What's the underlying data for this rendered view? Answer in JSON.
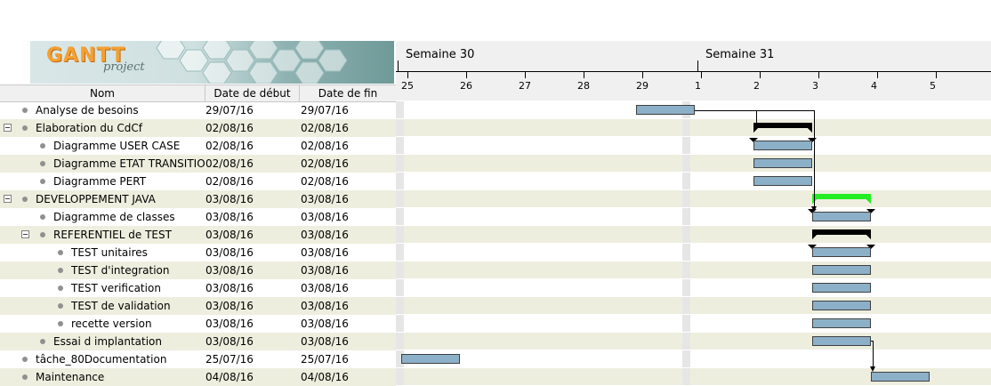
{
  "logo": {
    "main": "GANTT",
    "sub": "project"
  },
  "columns": {
    "name": "Nom",
    "start": "Date de début",
    "end": "Date de fin"
  },
  "weeks": [
    "Semaine 30",
    "Semaine 31"
  ],
  "days": [
    "25",
    "26",
    "27",
    "28",
    "29",
    "1",
    "2",
    "3",
    "4",
    "5"
  ],
  "tasks": [
    {
      "name": "Analyse de besoins",
      "start": "29/07/16",
      "end": "29/07/16",
      "level": 0,
      "group": false
    },
    {
      "name": "Elaboration du CdCf",
      "start": "02/08/16",
      "end": "02/08/16",
      "level": 0,
      "group": true
    },
    {
      "name": "Diagramme USER CASE",
      "start": "02/08/16",
      "end": "02/08/16",
      "level": 1,
      "group": false
    },
    {
      "name": "Diagramme ETAT TRANSITION",
      "start": "02/08/16",
      "end": "02/08/16",
      "level": 1,
      "group": false
    },
    {
      "name": "Diagramme PERT",
      "start": "02/08/16",
      "end": "02/08/16",
      "level": 1,
      "group": false
    },
    {
      "name": "DEVELOPPEMENT JAVA",
      "start": "03/08/16",
      "end": "03/08/16",
      "level": 0,
      "group": true
    },
    {
      "name": "Diagramme de classes",
      "start": "03/08/16",
      "end": "03/08/16",
      "level": 1,
      "group": false
    },
    {
      "name": "REFERENTIEL de TEST",
      "start": "03/08/16",
      "end": "03/08/16",
      "level": 1,
      "group": true
    },
    {
      "name": "TEST unitaires",
      "start": "03/08/16",
      "end": "03/08/16",
      "level": 2,
      "group": false
    },
    {
      "name": "TEST d'integration",
      "start": "03/08/16",
      "end": "03/08/16",
      "level": 2,
      "group": false
    },
    {
      "name": "TEST verification",
      "start": "03/08/16",
      "end": "03/08/16",
      "level": 2,
      "group": false
    },
    {
      "name": "TEST de validation",
      "start": "03/08/16",
      "end": "03/08/16",
      "level": 2,
      "group": false
    },
    {
      "name": "recette version",
      "start": "03/08/16",
      "end": "03/08/16",
      "level": 2,
      "group": false
    },
    {
      "name": "Essai d implantation",
      "start": "03/08/16",
      "end": "03/08/16",
      "level": 1,
      "group": false
    },
    {
      "name": "tâche_80Documentation",
      "start": "25/07/16",
      "end": "25/07/16",
      "level": 0,
      "group": false
    },
    {
      "name": "Maintenance",
      "start": "04/08/16",
      "end": "04/08/16",
      "level": 0,
      "group": false
    }
  ],
  "colors": {
    "task_bar": "#8cb0c8",
    "summary_bar": "#000000",
    "java_summary_bar": "#22ee22",
    "alt_row": "#eeeedf"
  }
}
